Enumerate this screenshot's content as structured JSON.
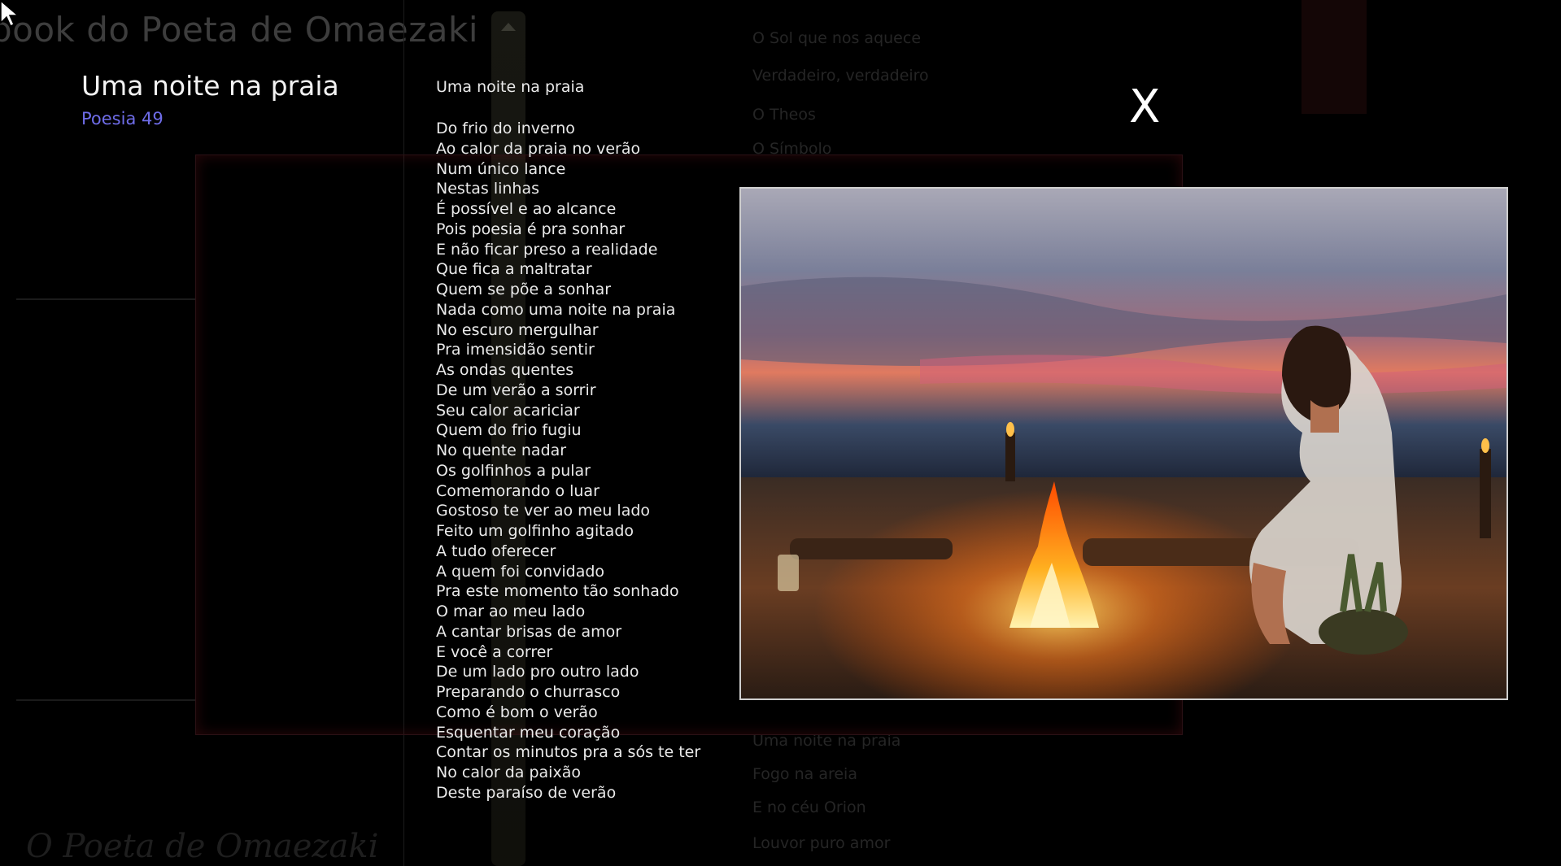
{
  "book_title": "book do Poeta de Omaezaki",
  "poem": {
    "heading": "Uma noite na praia",
    "number_label": "Poesia 49",
    "title": "Uma noite na praia",
    "lines": [
      "Do frio do inverno",
      "Ao calor da praia no verão",
      "Num único lance",
      "Nestas linhas",
      "É possível e ao alcance",
      "Pois poesia é pra sonhar",
      "E não ficar preso a realidade",
      "Que fica a maltratar",
      "Quem se põe a sonhar",
      "Nada como uma noite na praia",
      "No escuro mergulhar",
      "Pra imensidão sentir",
      "As ondas quentes",
      "De um verão a sorrir",
      "Seu calor acariciar",
      "Quem do frio fugiu",
      "No quente nadar",
      "Os golfinhos a pular",
      "Comemorando o luar",
      "Gostoso te ver ao meu lado",
      "Feito um golfinho agitado",
      "A tudo oferecer",
      "A quem foi convidado",
      "Pra este momento tão sonhado",
      "O mar ao meu lado",
      "A cantar brisas de amor",
      "E você a correr",
      "De um lado pro outro lado",
      "Preparando o churrasco",
      "Como é bom o verão",
      "Esquentar meu coração",
      "Contar os minutos pra a sós te ter",
      "No calor da paixão",
      "Deste paraíso de verão"
    ]
  },
  "background_list_top": [
    "O Sol que nos aquece",
    "Verdadeiro, verdadeiro",
    "O Theos",
    "O Símbolo"
  ],
  "background_list_bottom": [
    "Uma noite na praia",
    "Fogo na areia",
    "E no céu Orion",
    "Louvor puro amor"
  ],
  "close_label": "X",
  "signature": "O Poeta de Omaezaki",
  "icons": {
    "close": "close-icon",
    "cursor": "cursor-arrow-icon"
  }
}
